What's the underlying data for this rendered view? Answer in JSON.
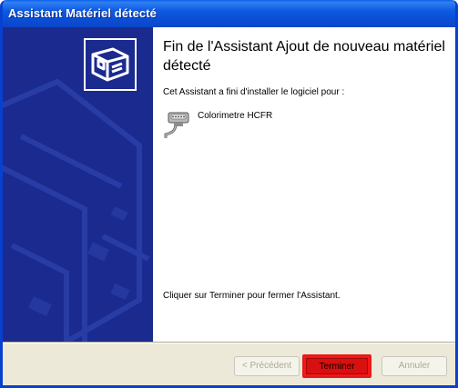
{
  "window": {
    "title": "Assistant Matériel détecté"
  },
  "main": {
    "heading": "Fin de l'Assistant Ajout de nouveau matériel détecté",
    "intro": "Cet Assistant a fini d'installer le logiciel pour :",
    "device_name": "Colorimetre HCFR",
    "device_icon": "serial-port-icon",
    "finish_text": "Cliquer sur Terminer pour fermer l'Assistant."
  },
  "buttons": {
    "back_label": "< Précédent",
    "finish_label": "Terminer",
    "cancel_label": "Annuler"
  },
  "colors": {
    "title_bar": "#0a4fd6",
    "watermark_panel": "#1a2a8f",
    "finish_highlight": "#ff1414"
  }
}
